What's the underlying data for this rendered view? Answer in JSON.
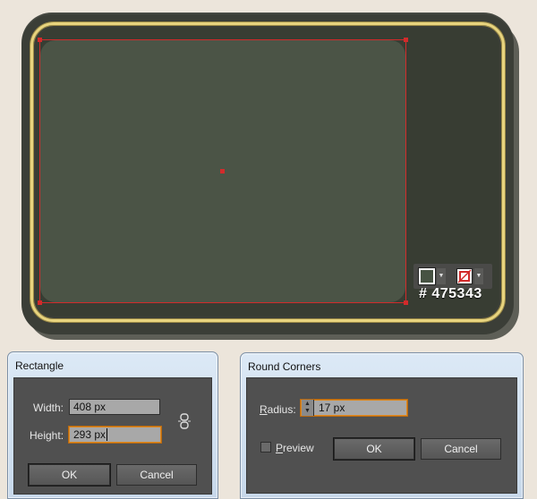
{
  "artwork": {
    "fill_color": "#475343",
    "hex_label": "# 475343",
    "stroke_color": "none",
    "icons": {
      "fill_swatch": "fill-swatch-icon",
      "stroke_swatch": "no-stroke-icon",
      "dropdown": "chevron-down-icon"
    }
  },
  "rectangle_dialog": {
    "title": "Rectangle",
    "width_label": "Width:",
    "width_value": "408 px",
    "height_label": "Height:",
    "height_value": "293 px",
    "ok_label": "OK",
    "cancel_label": "Cancel",
    "constrain_icon": "link-icon"
  },
  "round_corners_dialog": {
    "title": "Round Corners",
    "radius_label_underlined": "R",
    "radius_label_rest": "adius:",
    "radius_value": "17 px",
    "preview_label_underlined": "P",
    "preview_label_rest": "review",
    "preview_checked": false,
    "ok_label": "OK",
    "cancel_label": "Cancel"
  }
}
